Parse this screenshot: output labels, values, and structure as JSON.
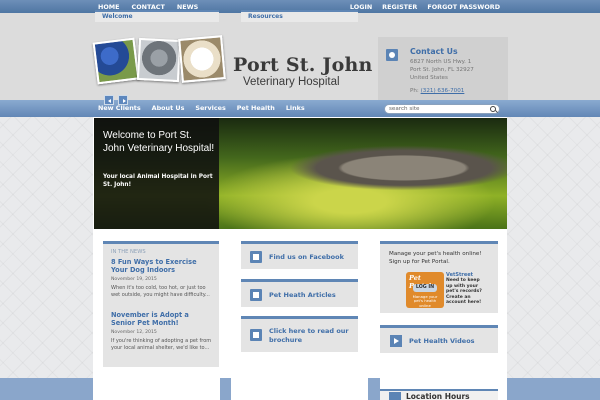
{
  "topbar": {
    "left": [
      "HOME",
      "CONTACT",
      "NEWS"
    ],
    "right": [
      "LOGIN",
      "REGISTER",
      "FORGOT PASSWORD"
    ]
  },
  "header": {
    "logo_title": "Port St. John",
    "logo_subtitle": "Veterinary Hospital"
  },
  "contact": {
    "title": "Contact Us",
    "address_line1": "6827 North US Hwy. 1",
    "address_line2": "Port St. John, FL 32927",
    "address_line3": "United States",
    "phone_label": "Ph:",
    "phone": "(321) 636-7001"
  },
  "nav": {
    "items": [
      "New Clients",
      "About Us",
      "Services",
      "Pet Health",
      "Links"
    ],
    "search_placeholder": "search site"
  },
  "slider": {
    "title": "Welcome to Port St. John Veterinary Hospital!",
    "subtitle": "Your local Animal Hospital in Port St. John!"
  },
  "news": {
    "label": "IN THE NEWS",
    "items": [
      {
        "title": "8 Fun Ways to Exercise Your Dog Indoors",
        "date": "November 19, 2015",
        "excerpt": "When it's too cold, too hot, or just too wet outside, you might have difficulty..."
      },
      {
        "title": "November is Adopt a Senior Pet Month!",
        "date": "November 12, 2015",
        "excerpt": "If you're thinking of adopting a pet from your local animal shelter, we'd like to..."
      }
    ]
  },
  "middle": {
    "facebook": "Find us on Facebook",
    "articles": "Pet Heath Articles",
    "brochure": "Click here to read our brochure"
  },
  "petportal": {
    "text": "Manage your pet's health online! Sign up for Pet Portal.",
    "logo": "Pet Portal",
    "login": "LOG IN",
    "logo_tag": "Manage your pet's health online",
    "vetstreet": "VetStreet",
    "side1": "Need to keep up with your pet's records?",
    "side2": "Create an account here!"
  },
  "videos": {
    "label": "Pet Health Videos"
  },
  "bottom": {
    "welcome": "Welcome",
    "resources": "Resources",
    "hours": "Location Hours"
  }
}
